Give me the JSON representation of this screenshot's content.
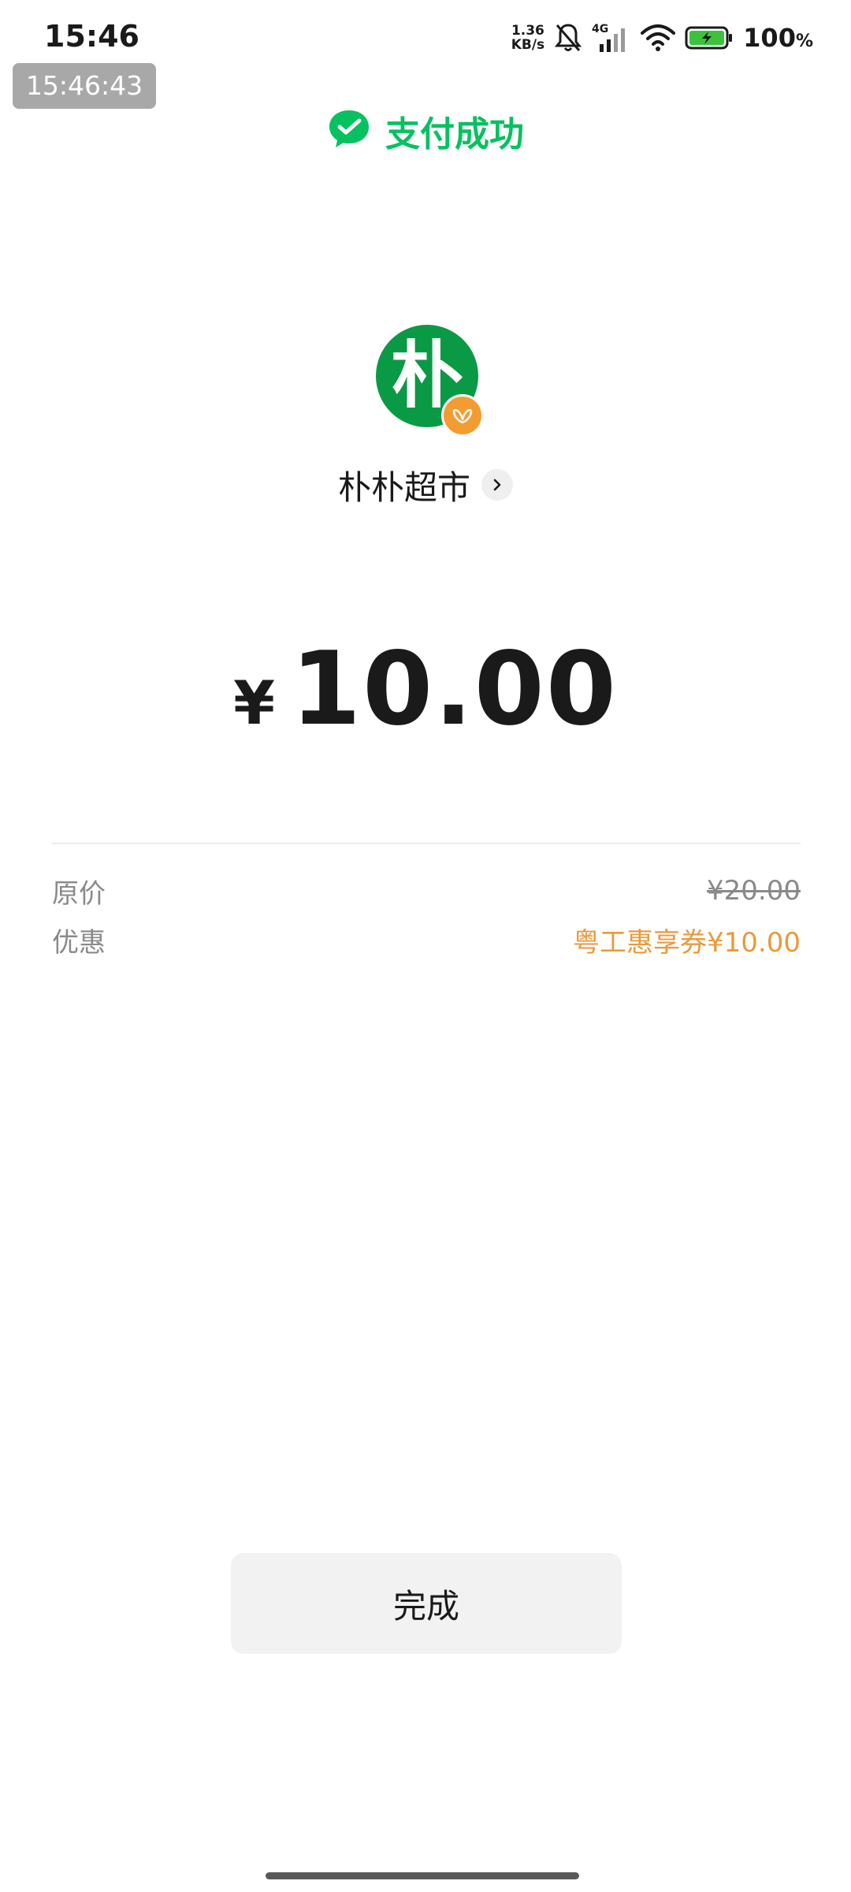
{
  "status_bar": {
    "time": "15:46",
    "net_speed_value": "1.36",
    "net_speed_unit": "KB/s",
    "network_type": "4G",
    "battery_percent": "100",
    "battery_percent_sign": "%",
    "icons": [
      "muted-bell-icon",
      "signal-icon",
      "wifi-icon",
      "battery-charging-icon"
    ]
  },
  "screenshot_timestamp": "15:46:43",
  "header": {
    "title": "支付成功",
    "icon": "wechat-pay-icon",
    "accent_color": "#07c160"
  },
  "merchant": {
    "logo_char": "朴",
    "name": "朴朴超市",
    "logo_color": "#0a9a45",
    "badge_color": "#f39c32"
  },
  "payment": {
    "currency_symbol": "¥",
    "amount": "10.00"
  },
  "details": {
    "original_price_label": "原价",
    "original_price_value": "¥20.00",
    "discount_label": "优惠",
    "discount_value": "粤工惠享券¥10.00",
    "discount_color": "#e89a3c"
  },
  "actions": {
    "done_label": "完成"
  }
}
